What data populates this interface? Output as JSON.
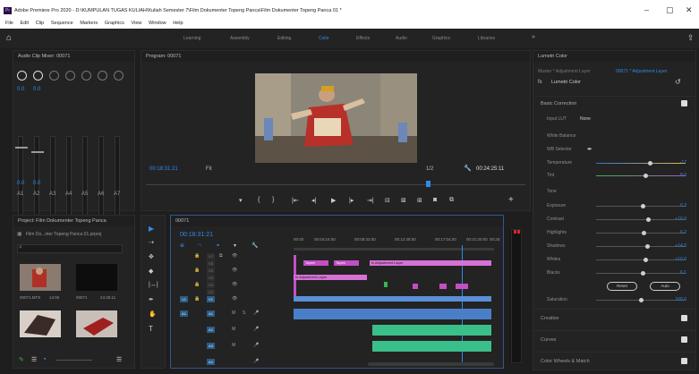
{
  "window": {
    "title": "Adobe Premiere Pro 2020 - D:\\KUMPULAN TUGAS KULIAH\\Kuliah Semester 7\\Film Dokumenter Topeng Panca\\Film Dokumenter Topeng Panca 01 *",
    "app_icon": "Pr",
    "minimize": "–",
    "maximize": "▢",
    "close": "✕"
  },
  "menu": [
    "File",
    "Edit",
    "Clip",
    "Sequence",
    "Markers",
    "Graphics",
    "View",
    "Window",
    "Help"
  ],
  "workspaces": [
    "Learning",
    "Assembly",
    "Editing",
    "Color",
    "Effects",
    "Audio",
    "Graphics",
    "Libraries"
  ],
  "active_workspace": "Color",
  "audio_mixer": {
    "title": "Audio Clip Mixer: 00071",
    "level_values": [
      "0.0",
      "0.0"
    ],
    "bottom_values": [
      "0.0",
      "0.0"
    ],
    "channel_labels": [
      "A1",
      "A2",
      "A3",
      "A4",
      "A5",
      "A6",
      "A7"
    ]
  },
  "program": {
    "title": "Program: 00071",
    "timecode_left": "00:18:31:21",
    "fit": "Fit",
    "zoom": "1/2",
    "timecode_right": "00:24:25:11"
  },
  "project": {
    "title": "Project: Film Dokumenter Topeng Panca",
    "file": "Film Do...nter Topeng Panca 01.prproj",
    "items": [
      {
        "name": "00071.MTS",
        "dur": "14:06"
      },
      {
        "name": "00071",
        "dur": "24:25:11"
      }
    ]
  },
  "timeline": {
    "title": "00071",
    "timecode": "00:18:31:21",
    "ruler": [
      "00:00",
      "00:04:16:00",
      "00:08:32:00",
      "00:12:48:00",
      "00:17:04:00",
      "00:21:20:00",
      "00:25:"
    ],
    "video_tracks": [
      "V7",
      "V6",
      "V5",
      "V4",
      "V3",
      "V2",
      "V1"
    ],
    "audio_tracks": [
      "A1",
      "A2",
      "A3",
      "A4"
    ],
    "clips": {
      "adjustment_top": "fx  Adjustment Layer",
      "adjustment_v4": "fx  Adjustment Layer",
      "topeng1": "Topen",
      "topeng2": "Topen"
    }
  },
  "lumetri": {
    "panel_title": "Lumetri Color",
    "source": "Master * Adjustment Layer",
    "sequence_link": "00071 * Adjustment Layer",
    "effect_name": "Lumetri Color",
    "basic_correction": "Basic Correction",
    "input_lut_label": "Input LUT",
    "input_lut_value": "None",
    "white_balance": "White Balance",
    "wb_selector": "WB Selector",
    "tone": "Tone",
    "reset_label": "Reset",
    "auto_label": "Auto",
    "params": [
      {
        "name": "Temperature",
        "value": "-17",
        "pos": 0.6
      },
      {
        "name": "Tint",
        "value": "8.0",
        "pos": 0.55
      },
      {
        "name": "Exposure",
        "value": "0.3",
        "pos": 0.52
      },
      {
        "name": "Contrast",
        "value": "+16.0",
        "pos": 0.58
      },
      {
        "name": "Highlights",
        "value": "6.2",
        "pos": 0.53
      },
      {
        "name": "Shadows",
        "value": "+14.0",
        "pos": 0.57
      },
      {
        "name": "Whites",
        "value": "+10.0",
        "pos": 0.55
      },
      {
        "name": "Blacks",
        "value": "6.1",
        "pos": 0.52
      },
      {
        "name": "Saturation",
        "value": "100.0",
        "pos": 0.5
      }
    ],
    "sections": [
      "Creative",
      "Curves",
      "Color Wheels & Match"
    ]
  }
}
